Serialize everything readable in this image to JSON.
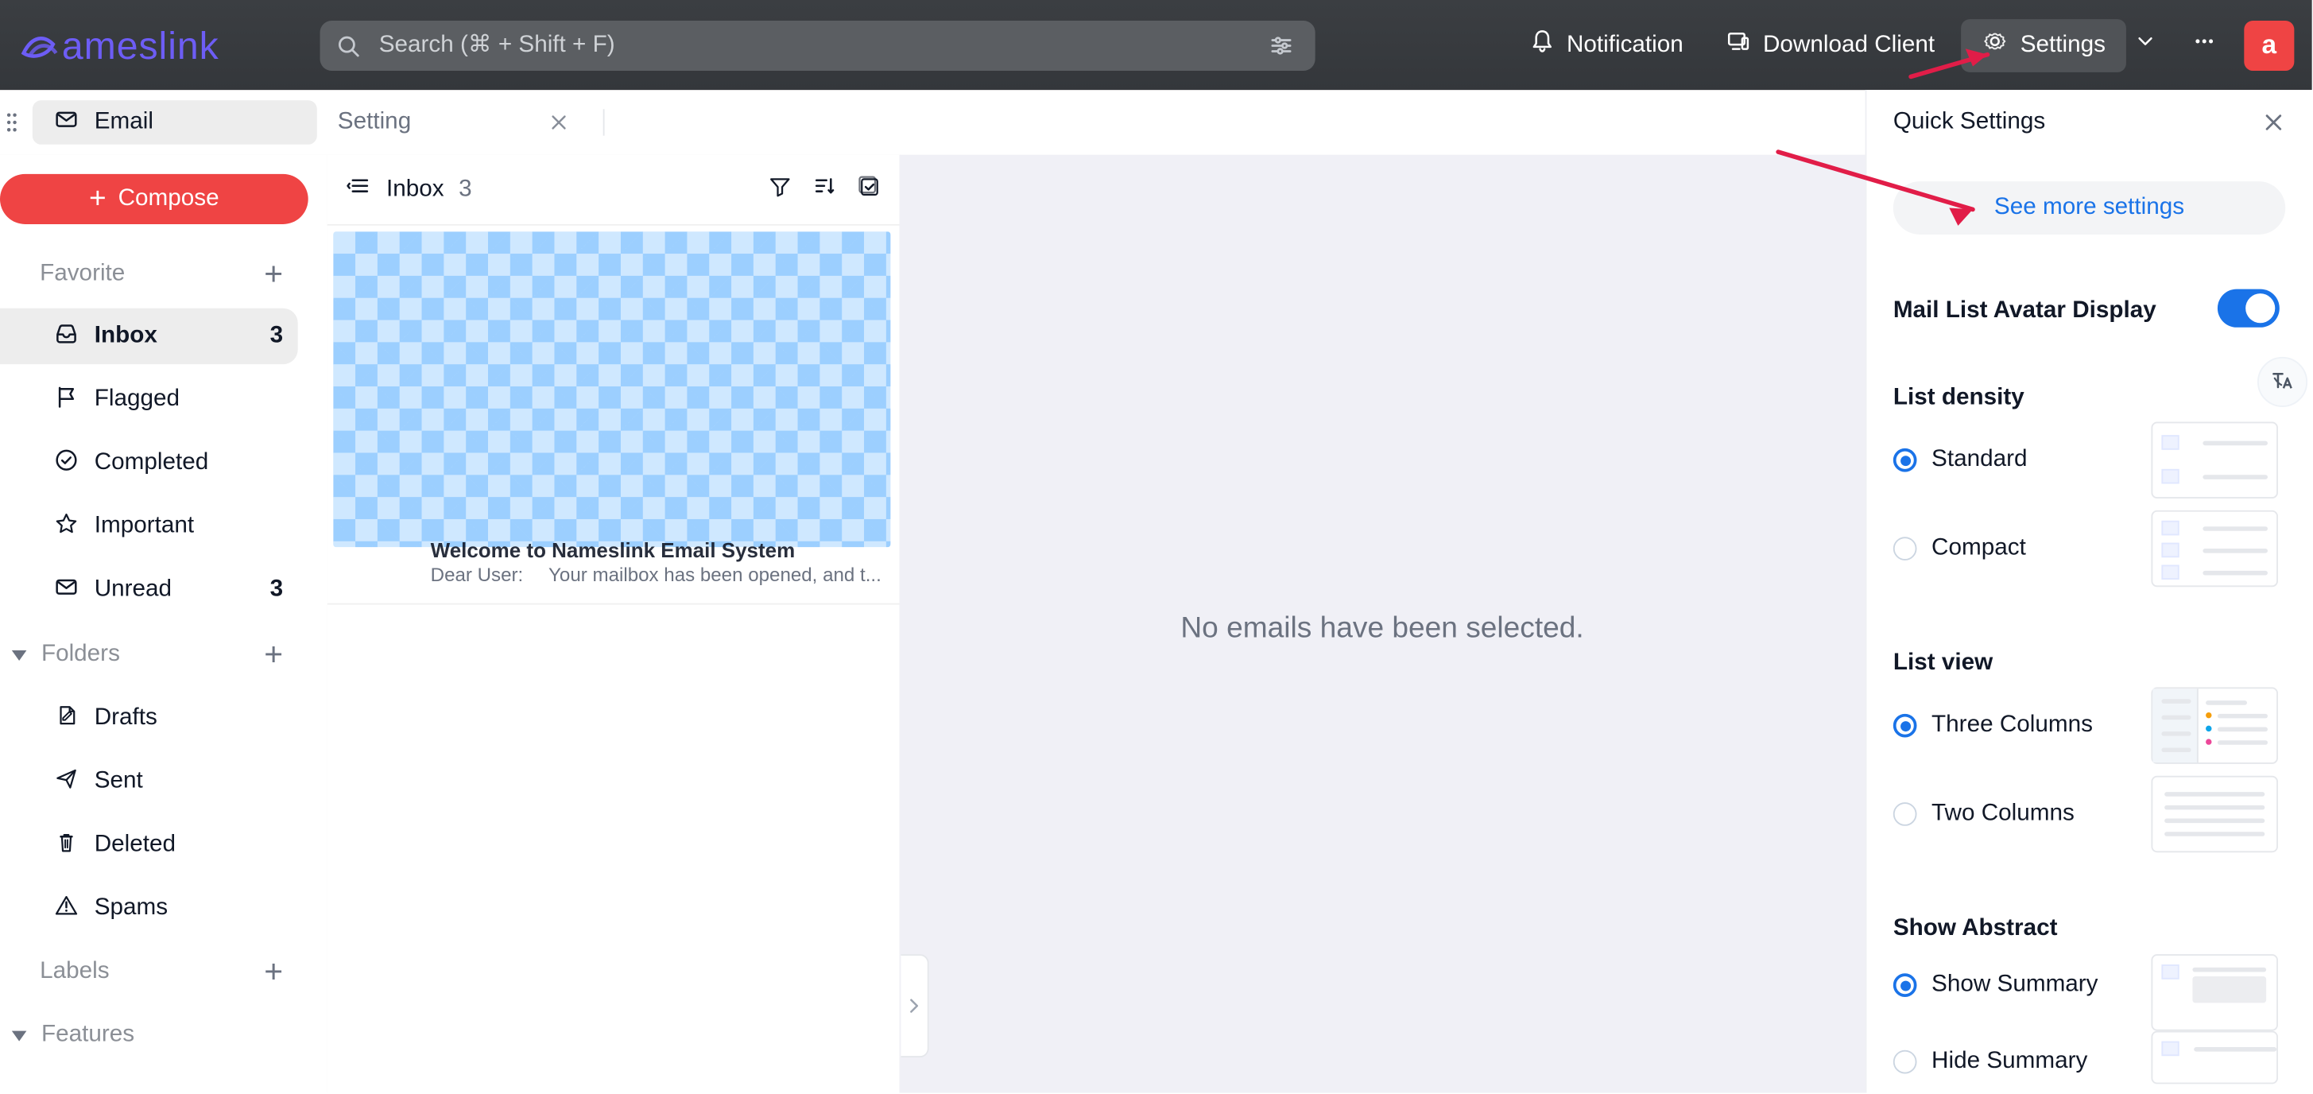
{
  "app": {
    "brand_text": "ameslink"
  },
  "topbar": {
    "search_placeholder": "Search (⌘ + Shift + F)",
    "notification_label": "Notification",
    "download_label": "Download Client",
    "settings_label": "Settings",
    "avatar_letter": "a",
    "colors": {
      "topbar": "#3a3d41",
      "accent": "#1a73e8",
      "danger": "#ef4444"
    }
  },
  "tabs": [
    {
      "label": "Email",
      "active": true
    },
    {
      "label": "Setting",
      "active": false
    }
  ],
  "sidebar": {
    "compose_label": "Compose",
    "favorite_label": "Favorite",
    "favorite_items": [
      {
        "label": "Inbox",
        "count": "3",
        "active": true,
        "icon": "inbox-icon"
      },
      {
        "label": "Flagged",
        "count": "",
        "active": false,
        "icon": "flag-icon"
      },
      {
        "label": "Completed",
        "count": "",
        "active": false,
        "icon": "check-circle-icon"
      },
      {
        "label": "Important",
        "count": "",
        "active": false,
        "icon": "star-icon"
      },
      {
        "label": "Unread",
        "count": "3",
        "active": false,
        "icon": "mail-icon"
      }
    ],
    "folders_label": "Folders",
    "folder_items": [
      {
        "label": "Drafts",
        "icon": "drafts-icon"
      },
      {
        "label": "Sent",
        "icon": "send-icon"
      },
      {
        "label": "Deleted",
        "icon": "trash-icon"
      },
      {
        "label": "Spams",
        "icon": "warning-icon"
      }
    ],
    "labels_label": "Labels",
    "features_label": "Features"
  },
  "maillist": {
    "title": "Inbox",
    "count": "3",
    "items": [
      {
        "subject": "Welcome to Nameslink Email System",
        "sender": "Dear User:",
        "preview": "Your mailbox has been opened, and t..."
      }
    ]
  },
  "reading": {
    "empty_text": "No emails have been selected."
  },
  "quick_settings": {
    "title": "Quick Settings",
    "see_more_label": "See more settings",
    "avatar_display_label": "Mail List Avatar Display",
    "avatar_display_on": true,
    "list_density_label": "List density",
    "density_options": [
      {
        "label": "Standard",
        "checked": true
      },
      {
        "label": "Compact",
        "checked": false
      }
    ],
    "list_view_label": "List view",
    "view_options": [
      {
        "label": "Three Columns",
        "checked": true
      },
      {
        "label": "Two Columns",
        "checked": false
      }
    ],
    "show_abstract_label": "Show Abstract",
    "abstract_options": [
      {
        "label": "Show Summary",
        "checked": true
      },
      {
        "label": "Hide Summary",
        "checked": false
      }
    ]
  }
}
